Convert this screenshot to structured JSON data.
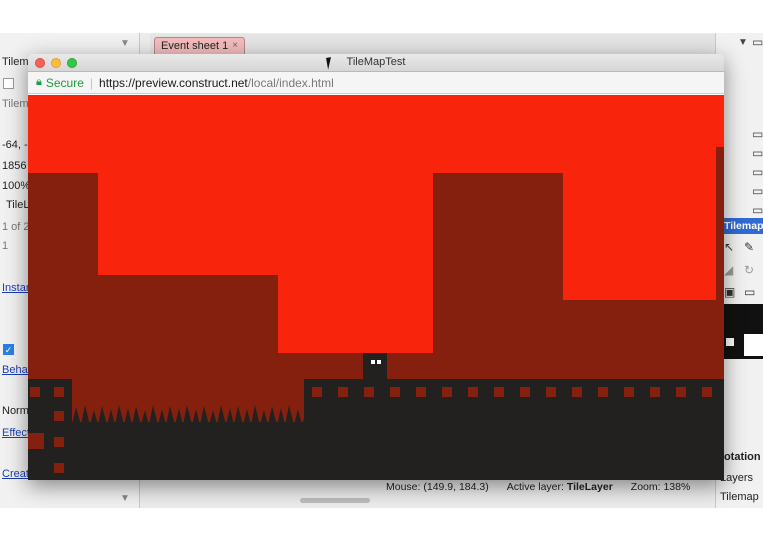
{
  "editor": {
    "tab_label": "Event sheet 1",
    "tab_close": "×",
    "left_panel": {
      "rows": [
        "Tilem",
        "",
        "Tilem",
        "-64, -",
        "1856",
        "100%",
        "TileL",
        "1 of 2",
        "1",
        "Instan",
        "Behav",
        "Norm",
        "Effect",
        "Creat"
      ],
      "check_mark": "✓"
    },
    "status": {
      "mouse_label": "Mouse:",
      "mouse_value": "(149.9, 184.3)",
      "layer_label": "Active layer:",
      "layer_value": "TileLayer",
      "zoom_label": "Zoom:",
      "zoom_value": "138%"
    },
    "right_panel": {
      "tilemap_header": "Tilemap:",
      "rotation_label": "Rotation",
      "layers_label": "Layers",
      "tilemap_label": "Tilemap"
    }
  },
  "browser": {
    "title": "TileMapTest",
    "secure_label": "Secure",
    "url_host": "https://preview.construct.net",
    "url_path": "/local/index.html"
  },
  "colors": {
    "sky": "#f8240c",
    "background_wall": "#85200f",
    "ground": "#232020",
    "selection": "#2f6bd3"
  },
  "icons": {
    "lock": "lock-icon",
    "arrow": "select-arrow-icon",
    "pencil": "pencil-icon",
    "eraser": "eraser-icon",
    "rotate": "rotate-icon",
    "save": "save-icon",
    "folder": "folder-icon",
    "cursor": "mouse-cursor-icon"
  }
}
